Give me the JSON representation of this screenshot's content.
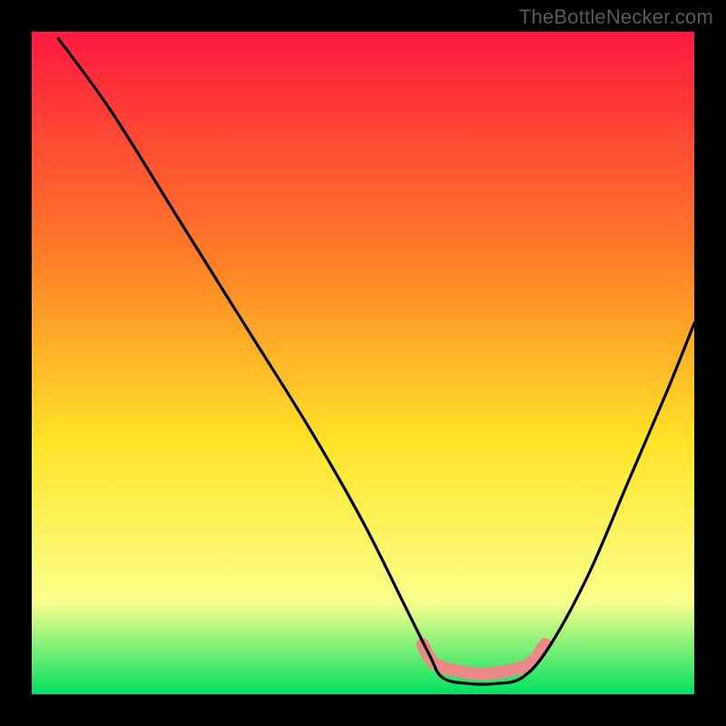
{
  "watermark": "TheBottleNecker.com",
  "chart_data": {
    "type": "line",
    "title": "",
    "xlabel": "",
    "ylabel": "",
    "xlim": [
      0,
      100
    ],
    "ylim": [
      0,
      100
    ],
    "gradient": {
      "top": "#ff1a40",
      "mid1": "#ff7a28",
      "mid2": "#ffe428",
      "mid3": "#fbff8c",
      "bottom": "#00e060"
    },
    "curve": {
      "comment": "black asymmetric V / check-shaped curve; minimum plateau around x 62-74 near bottom",
      "points": [
        {
          "x": 4,
          "y": 99
        },
        {
          "x": 12,
          "y": 88
        },
        {
          "x": 22,
          "y": 72
        },
        {
          "x": 32,
          "y": 56
        },
        {
          "x": 42,
          "y": 40
        },
        {
          "x": 50,
          "y": 26
        },
        {
          "x": 56,
          "y": 14
        },
        {
          "x": 60,
          "y": 6
        },
        {
          "x": 62,
          "y": 2.5
        },
        {
          "x": 66,
          "y": 1.6
        },
        {
          "x": 70,
          "y": 1.6
        },
        {
          "x": 74,
          "y": 2.5
        },
        {
          "x": 78,
          "y": 7
        },
        {
          "x": 84,
          "y": 18
        },
        {
          "x": 90,
          "y": 32
        },
        {
          "x": 96,
          "y": 46
        },
        {
          "x": 100,
          "y": 56
        }
      ]
    },
    "highlight_band": {
      "comment": "soft pink band marking the sweet-spot / plateau region along the curve",
      "color": "#e98a87",
      "segments": [
        {
          "x": 59,
          "y": 7.5
        },
        {
          "x": 61,
          "y": 4.5
        },
        {
          "x": 66,
          "y": 3.2
        },
        {
          "x": 70,
          "y": 3.2
        },
        {
          "x": 75,
          "y": 4.5
        },
        {
          "x": 77.5,
          "y": 7.5
        }
      ]
    }
  }
}
